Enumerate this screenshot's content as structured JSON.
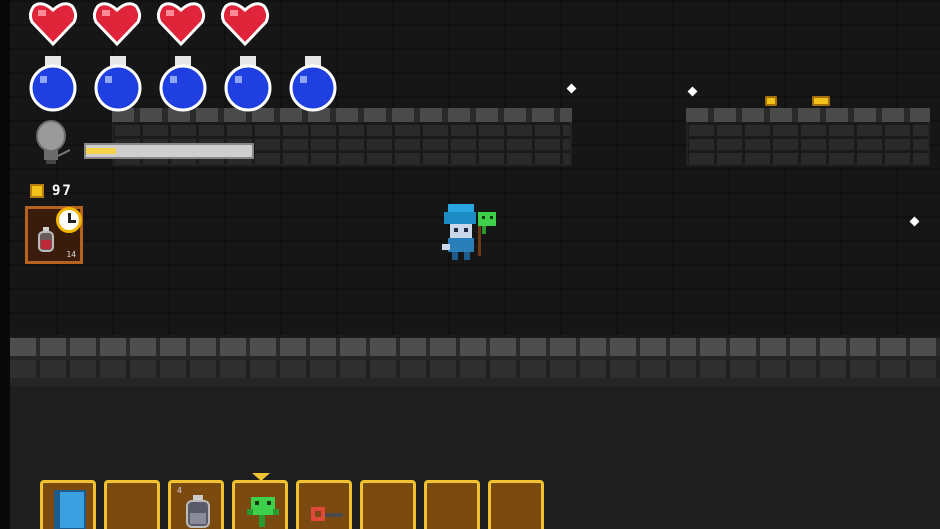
{
  "hud": {
    "hearts": [
      {
        "name": "heart-1",
        "state": "full"
      },
      {
        "name": "heart-2",
        "state": "full"
      },
      {
        "name": "heart-3",
        "state": "full"
      },
      {
        "name": "heart-4",
        "state": "full"
      }
    ],
    "mana_potions": [
      {
        "name": "mana-1",
        "state": "full"
      },
      {
        "name": "mana-2",
        "state": "full"
      },
      {
        "name": "mana-3",
        "state": "full"
      },
      {
        "name": "mana-4",
        "state": "full"
      },
      {
        "name": "mana-5",
        "state": "full"
      }
    ],
    "light": {
      "icon": "lightbulb-icon",
      "level": 0.18
    },
    "coins": {
      "icon": "coin-icon",
      "count": "97"
    },
    "buff": {
      "icon": "potion-icon",
      "timer_icon": "clock-icon",
      "count": "14"
    }
  },
  "hotbar": {
    "selected_index": 3,
    "slots": [
      {
        "item": "blue-spellbook-icon",
        "count": ""
      },
      {
        "item": "",
        "count": ""
      },
      {
        "item": "potion-bottle-icon",
        "count": "4"
      },
      {
        "item": "green-slime-pet-icon",
        "count": ""
      },
      {
        "item": "red-key-icon",
        "count": ""
      },
      {
        "item": "",
        "count": ""
      },
      {
        "item": "",
        "count": ""
      },
      {
        "item": "",
        "count": ""
      }
    ]
  },
  "colors": {
    "heart": "#e0243a",
    "mana": "#1f3fe0",
    "slot_border": "#f1c232",
    "slot_fill": "#7a4a10",
    "gold": "#f2c21a"
  }
}
